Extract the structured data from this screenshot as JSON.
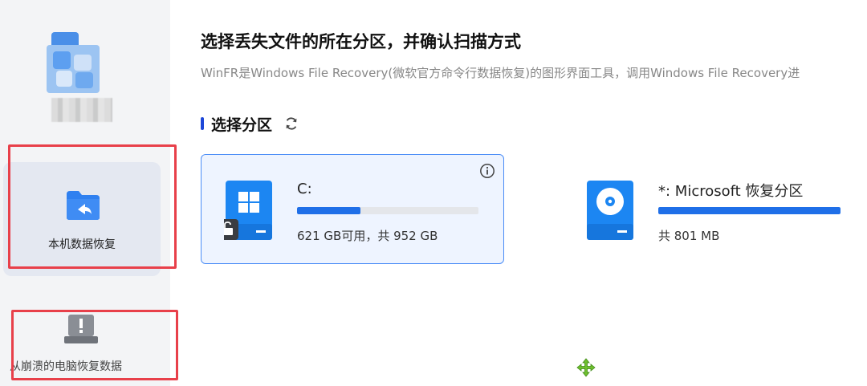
{
  "app": {
    "title": "选择丢失文件的所在分区，并确认扫描方式",
    "description": "WinFR是Windows File Recovery(微软官方命令行数据恢复)的图形界面工具，调用Windows File Recovery进"
  },
  "sidebar": {
    "items": [
      {
        "label": "本机数据恢复",
        "icon": "folder-back-icon",
        "active": true
      },
      {
        "label": "从崩溃的电脑恢复数据",
        "icon": "laptop-warning-icon",
        "active": false
      }
    ]
  },
  "partition": {
    "heading": "选择分区",
    "drives": [
      {
        "name": "C:",
        "size_text": "621 GB可用，共 952 GB",
        "used_fraction": 0.35,
        "selected": true,
        "icon": "windows-drive-icon",
        "locked": true
      },
      {
        "name": "*: Microsoft 恢复分区",
        "size_text": "共 801 MB",
        "used_fraction": 1.0,
        "selected": false,
        "icon": "disc-drive-icon",
        "locked": false
      }
    ]
  },
  "colors": {
    "accent": "#1f6fe8",
    "highlight": "#e8404a",
    "selected_bg": "#eef4ff"
  }
}
